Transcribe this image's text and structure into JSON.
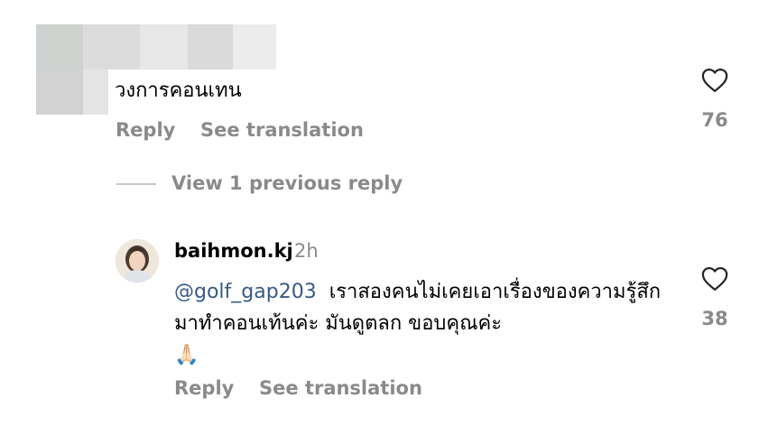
{
  "comment1": {
    "text": "วงการคอนเทน",
    "reply_label": "Reply",
    "translate_label": "See translation",
    "like_count": "76"
  },
  "view_replies_label": "View 1 previous reply",
  "reply": {
    "username": "baihmon.kj",
    "time": "2h",
    "mention": "@golf_gap203",
    "text": "เราสองคนไม่เคยเอาเรื่องของความรู้สึกมาทำคอนเท้นค่ะ มันดูตลก ขอบคุณค่ะ",
    "emoji": "🙏🏻",
    "reply_label": "Reply",
    "translate_label": "See translation",
    "like_count": "38"
  },
  "colors": {
    "secondary_text": "#8a8a8a",
    "mention": "#385a85",
    "divider": "#c7c7c7"
  },
  "icons": {
    "like": "heart-outline-icon"
  }
}
